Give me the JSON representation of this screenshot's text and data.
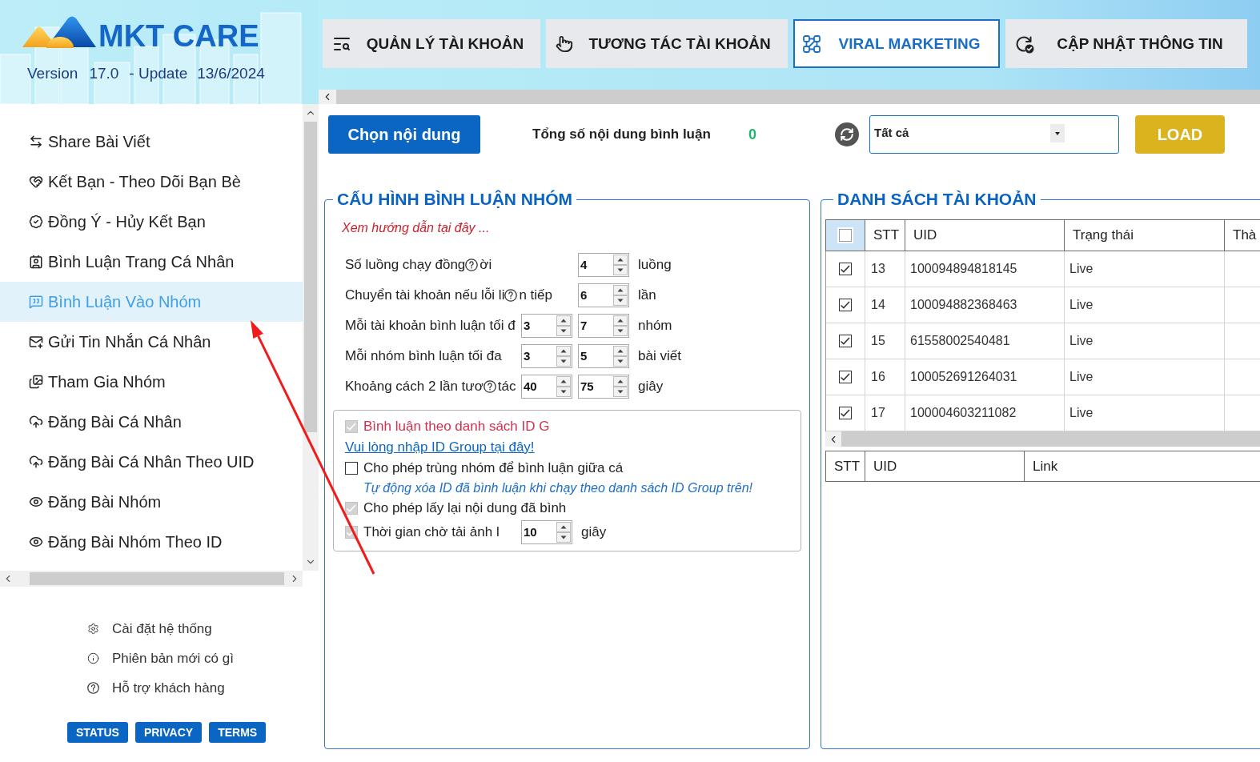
{
  "header": {
    "logo_text": "MKT CARE",
    "version_label": "Version",
    "version": "17.0",
    "update_label": "- Update",
    "update_date": "13/6/2024"
  },
  "tabs": [
    {
      "label": "QUẢN LÝ TÀI KHOẢN",
      "selected": false
    },
    {
      "label": "TƯƠNG TÁC TÀI KHOẢN",
      "selected": false
    },
    {
      "label": "VIRAL MARKETING",
      "selected": true
    },
    {
      "label": "CẬP NHẬT THÔNG TIN",
      "selected": false
    }
  ],
  "sidebar": {
    "items": [
      {
        "label": "Share Bài Viết",
        "selected": false
      },
      {
        "label": "Kết Bạn - Theo Dõi Bạn Bè",
        "selected": false
      },
      {
        "label": "Đồng Ý - Hủy Kết Bạn",
        "selected": false
      },
      {
        "label": "Bình Luận Trang Cá Nhân",
        "selected": false
      },
      {
        "label": "Bình Luận Vào Nhóm",
        "selected": true
      },
      {
        "label": "Gửi Tin Nhắn Cá Nhân",
        "selected": false
      },
      {
        "label": "Tham Gia Nhóm",
        "selected": false
      },
      {
        "label": "Đăng Bài Cá Nhân",
        "selected": false
      },
      {
        "label": "Đăng Bài Cá Nhân Theo UID",
        "selected": false
      },
      {
        "label": "Đăng Bài Nhóm",
        "selected": false
      },
      {
        "label": "Đăng Bài Nhóm Theo ID",
        "selected": false
      }
    ],
    "links": [
      "Cài đặt hệ thống",
      "Phiên bản mới có gì",
      "Hỗ trợ khách hàng"
    ],
    "footer_buttons": [
      "STATUS",
      "PRIVACY",
      "TERMS"
    ]
  },
  "toolbar": {
    "choose_button": "Chọn nội dung",
    "total_label": "Tổng số nội dung bình luận",
    "total_value": "0",
    "filter_value": "Tất cả",
    "load_button": "LOAD"
  },
  "config": {
    "title": "CẤU HÌNH BÌNH LUẬN NHÓM",
    "guide": "Xem hướng dẫn tại đây ...",
    "rows": [
      {
        "label": "Số luồng chạy đồng",
        "help": true,
        "label_after": "ời",
        "values": [
          "4"
        ],
        "unit": "luồng"
      },
      {
        "label": "Chuyển tài khoản nếu lỗi li",
        "help": true,
        "label_after": "n tiếp",
        "values": [
          "6"
        ],
        "unit": "lần"
      },
      {
        "label": "Mỗi tài khoản bình luận tối đ",
        "help": false,
        "values": [
          "3",
          "7"
        ],
        "unit": "nhóm"
      },
      {
        "label": "Mỗi nhóm bình luận tối đa",
        "help": false,
        "values": [
          "3",
          "5"
        ],
        "unit": "bài viết"
      },
      {
        "label": "Khoảng cách 2 lần tươ",
        "help": true,
        "label_after": "tác",
        "values": [
          "40",
          "75"
        ],
        "unit": "giây"
      }
    ],
    "options": [
      {
        "kind": "checkbox",
        "label": "Bình luận theo danh sách ID G",
        "checked": true,
        "disabled": true,
        "color": "#d0314f"
      },
      {
        "kind": "link",
        "label": "Vui lòng nhập ID Group tại đây!"
      },
      {
        "kind": "checkbox",
        "label": "Cho phép trùng nhóm để bình luận giữa cá",
        "checked": false,
        "disabled": false,
        "color": "#222222"
      },
      {
        "kind": "note",
        "label": "Tự động xóa ID đã bình luận khi chạy theo danh sách ID Group trên!"
      },
      {
        "kind": "checkbox",
        "label": "Cho phép lấy lại nội dung đã bình",
        "checked": true,
        "disabled": true,
        "color": "#222222"
      },
      {
        "kind": "checkbox_number",
        "label": "Thời gian chờ tải ảnh l",
        "checked": true,
        "disabled": true,
        "color": "#222222",
        "value": "10",
        "unit": "giây"
      }
    ]
  },
  "accounts": {
    "title": "DANH SÁCH TÀI KHOẢN",
    "select_all_checked": false,
    "columns": [
      "STT",
      "UID",
      "Trạng thái",
      "Thà"
    ],
    "rows": [
      {
        "checked": true,
        "stt": "13",
        "uid": "100094894818145",
        "status": "Live"
      },
      {
        "checked": true,
        "stt": "14",
        "uid": "100094882368463",
        "status": "Live"
      },
      {
        "checked": true,
        "stt": "15",
        "uid": "61558002540481",
        "status": "Live"
      },
      {
        "checked": true,
        "stt": "16",
        "uid": "100052691264031",
        "status": "Live"
      },
      {
        "checked": true,
        "stt": "17",
        "uid": "100004603211082",
        "status": "Live"
      }
    ]
  },
  "links_table": {
    "columns": [
      "STT",
      "UID",
      "Link"
    ]
  }
}
